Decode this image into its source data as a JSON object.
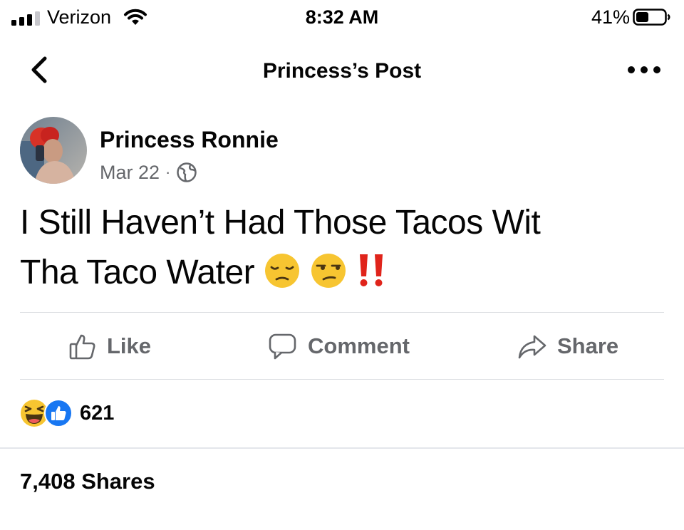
{
  "status_bar": {
    "carrier": "Verizon",
    "time": "8:32 AM",
    "battery_percent": "41%",
    "signal_icon": "signal-bars-icon",
    "wifi_icon": "wifi-icon",
    "battery_icon": "battery-icon"
  },
  "nav": {
    "title": "Princess’s Post",
    "back_icon": "chevron-left-icon",
    "more_icon": "more-dots-icon"
  },
  "post": {
    "author": "Princess Ronnie",
    "date": "Mar 22",
    "separator": "·",
    "privacy_icon": "globe-icon",
    "text_line1": "I Still Haven’t Had Those Tacos Wit",
    "text_line2": "Tha Taco Water",
    "emojis": [
      "pensive-face",
      "unamused-face",
      "double-exclamation"
    ]
  },
  "actions": {
    "like_label": "Like",
    "comment_label": "Comment",
    "share_label": "Share"
  },
  "reactions": {
    "types": [
      "laughing-reaction",
      "like-reaction"
    ],
    "count": "621"
  },
  "shares": {
    "label": "7,408 Shares"
  },
  "colors": {
    "text_primary": "#050505",
    "text_secondary": "#65676b",
    "like_blue": "#1877f2",
    "divider": "#dadde1",
    "emoji_yellow": "#f7c531",
    "exclamation_red": "#e0241b"
  }
}
